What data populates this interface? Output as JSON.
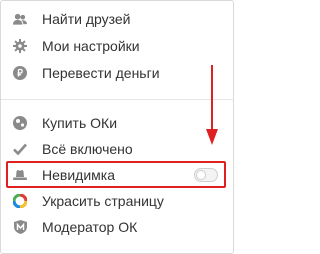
{
  "menu": {
    "items": [
      {
        "label": "Найти друзей",
        "icon": "friends-icon"
      },
      {
        "label": "Мои настройки",
        "icon": "gear-icon"
      },
      {
        "label": "Перевести деньги",
        "icon": "ruble-coin-icon"
      },
      {
        "label": "Купить ОКи",
        "icon": "ok-coins-icon"
      },
      {
        "label": "Всё включено",
        "icon": "checkmark-icon"
      },
      {
        "label": "Невидимка",
        "icon": "invisible-hat-icon",
        "toggle_on": false
      },
      {
        "label": "Украсить страницу",
        "icon": "color-wheel-icon"
      },
      {
        "label": "Модератор ОК",
        "icon": "moderator-shield-icon"
      }
    ]
  },
  "colors": {
    "icon_gray": "#8a8a8a",
    "text": "#333333",
    "annotation_red": "#e02020",
    "divider": "#e6e6e6"
  }
}
